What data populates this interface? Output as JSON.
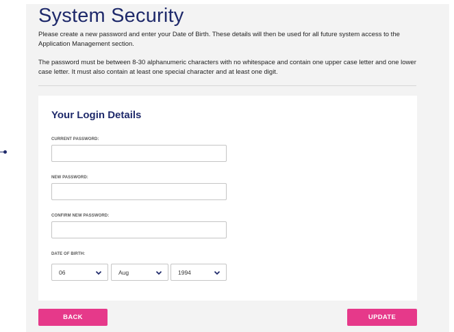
{
  "page": {
    "title": "System Security",
    "intro": "Please create a new password and enter your Date of Birth. These details will then be used for all future system access to the Application Management section.",
    "rules": "The password must be between 8-30 alphanumeric characters with no whitespace and contain one upper case letter and one lower case letter. It must also contain at least one special character and at least one digit."
  },
  "form": {
    "title": "Your Login Details",
    "current_password_label": "CURRENT PASSWORD:",
    "current_password_value": "",
    "new_password_label": "NEW PASSWORD:",
    "new_password_value": "",
    "confirm_password_label": "CONFIRM NEW PASSWORD:",
    "confirm_password_value": "",
    "dob_label": "DATE OF BIRTH:",
    "dob_day": "06",
    "dob_month": "Aug",
    "dob_year": "1994"
  },
  "buttons": {
    "back": "BACK",
    "update": "UPDATE"
  },
  "colors": {
    "heading": "#1f2a6b",
    "button": "#e6398a",
    "panel": "#f3f3f3"
  },
  "icons": {
    "chevron": "chevron-down-icon",
    "marker": "connector-dot-icon"
  }
}
